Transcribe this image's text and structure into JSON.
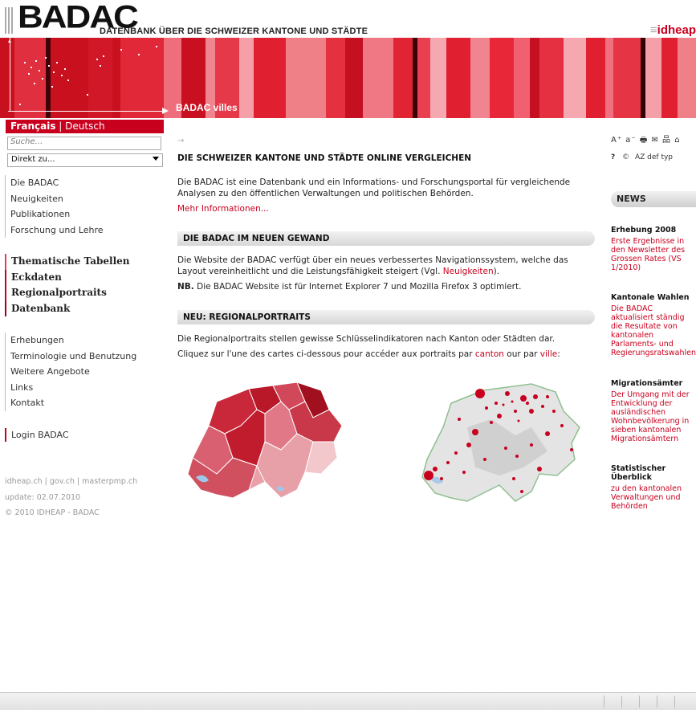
{
  "header": {
    "logo": "BADAC",
    "tagline": "DATENBANK ÜBER DIE SCHWEIZER KANTONE UND STÄDTE",
    "partner_logo": "idheap",
    "banner_label": "BADAC villes"
  },
  "language": {
    "active": "Français",
    "separator": "|",
    "other": "Deutsch"
  },
  "search": {
    "placeholder": "Suche..."
  },
  "jump_select": {
    "value": "Direkt zu..."
  },
  "sidebar": {
    "group1": [
      "Die BADAC",
      "Neuigkeiten",
      "Publikationen",
      "Forschung und Lehre"
    ],
    "group2": [
      "Thematische Tabellen",
      "Eckdaten",
      "Regionalportraits",
      "Datenbank"
    ],
    "group3": [
      "Erhebungen",
      "Terminologie und Benutzung",
      "Weitere Angebote",
      "Links",
      "Kontakt"
    ],
    "login": "Login BADAC",
    "footer_links": "idheap.ch | gov.ch | masterpmp.ch",
    "update": "update: 02.07.2010",
    "copyright": "© 2010 IDHEAP - BADAC"
  },
  "main": {
    "crumb": "→",
    "title": "DIE SCHWEIZER KANTONE UND STÄDTE ONLINE VERGLEICHEN",
    "intro": "Die BADAC ist eine Datenbank und ein Informations- und Forschungsportal für vergleichende Analysen zu den öffentlichen Verwaltungen und politischen Behörden.",
    "more_link": "Mehr Informationen...",
    "section1_title": "DIE BADAC IM NEUEN GEWAND",
    "section1_text_a": "Die Website der BADAC verfügt über ein neues verbessertes Navigationssystem, welche das Layout vereinheitlicht und die Leistungsfähigkeit steigert (Vgl. ",
    "section1_link": "Neuigkeiten",
    "section1_text_b": ").",
    "nb_label": "NB.",
    "nb_text": " Die BADAC Website ist für Internet Explorer 7 und Mozilla Firefox 3 optimiert.",
    "section2_title": "NEU: REGIONALPORTRAITS",
    "section2_text": "Die Regionalportraits stellen gewisse Schlüsselindikatoren nach Kanton oder Städten dar.",
    "click_text_a": "Cliquez sur l'une des cartes ci-dessous pour accéder aux portraits par ",
    "canton_link": "canton",
    "click_text_b": " our par ",
    "ville_link": "ville",
    "click_text_c": ":"
  },
  "tools": {
    "row1": "A⁺ a⁻ 🖶 ✉ 品 ⌂",
    "help": "?",
    "copyright_icon": "©",
    "index": "AZ def typ"
  },
  "news": {
    "label": "NEWS",
    "items": [
      {
        "title": "Erhebung 2008",
        "body": "Erste Ergebnisse in den Newsletter des Grossen Rates (VS 1/2010)"
      },
      {
        "title": "Kantonale Wahlen",
        "body": "Die BADAC aktualisiert ständig die Resultate von kantonalen Parlaments- und Regierungsratswahlen"
      },
      {
        "title": "Migrationsämter",
        "body": "Der Umgang mit der Entwicklung der ausländischen Wohnbevölkerung in sieben kantonalen Migrationsämtern"
      },
      {
        "title": "Statistischer Überblick",
        "body": "zu den kantonalen Verwaltungen und Behörden"
      }
    ]
  },
  "colors": {
    "accent": "#c8001e",
    "banner_dark": "#a0001a",
    "banner_light": "#f08090"
  }
}
